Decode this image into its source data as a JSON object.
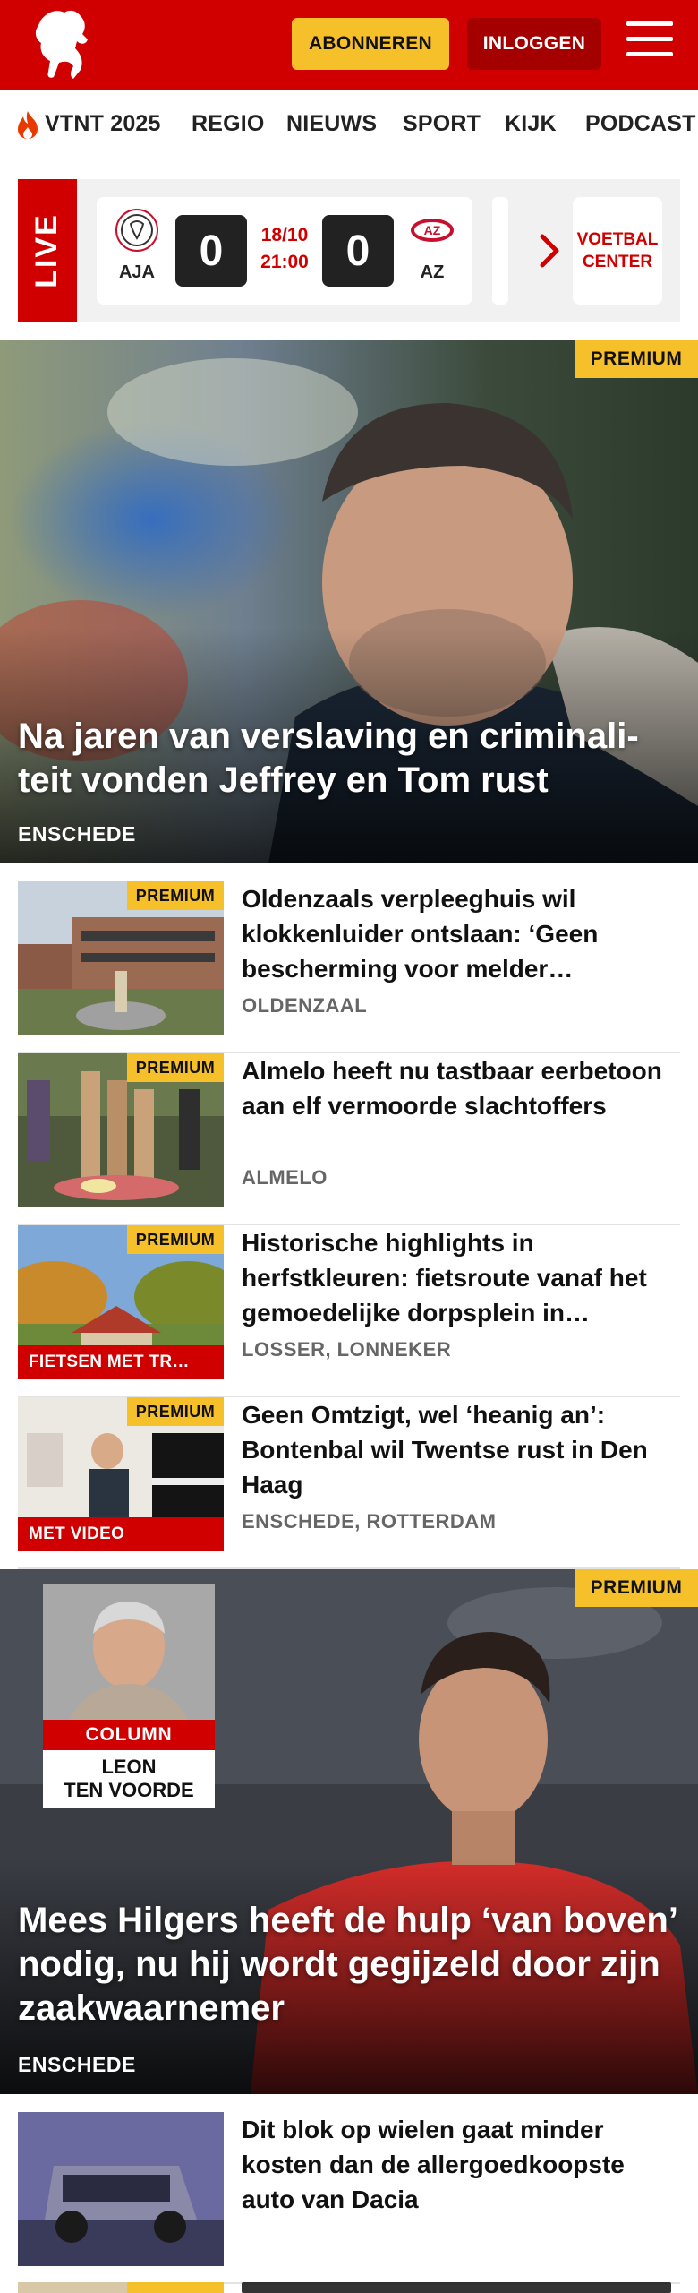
{
  "header": {
    "subscribe_label": "ABONNEREN",
    "login_label": "INLOGGEN",
    "brand_color": "#d00000",
    "accent_color": "#f5c02a",
    "logo_icon": "twente-horse-logo",
    "menu_icon": "hamburger-menu-icon"
  },
  "nav": {
    "items": [
      "VTNT 2025",
      "REGIO",
      "NIEUWS",
      "SPORT",
      "KIJK",
      "PODCAST"
    ],
    "active_icon": "flame-icon"
  },
  "live": {
    "label": "LIVE",
    "match": {
      "home_abbr": "AJA",
      "away_abbr": "AZ",
      "home_score": "0",
      "away_score": "0",
      "date": "18/10",
      "time": "21:00"
    },
    "voetbal_center": "VOETBAL CENTER"
  },
  "hero1": {
    "premium": "PREMIUM",
    "title": "Na jaren van verslaving en criminali-teit vonden Jeffrey en Tom rust",
    "location": "ENSCHEDE"
  },
  "articles": [
    {
      "premium": "PREMIUM",
      "title": "Oldenzaals verpleeghuis wil klokkenluider ontslaan: ‘Geen bescherming voor melder…",
      "location": "OLDENZAAL",
      "tag": ""
    },
    {
      "premium": "PREMIUM",
      "title": "Almelo heeft nu tastbaar eerbetoon aan elf vermoorde slachtoffers",
      "location": "ALMELO",
      "tag": ""
    },
    {
      "premium": "PREMIUM",
      "title": "Historische highlights in herfstkleuren: fietsroute vanaf het gemoedelijke dorpsplein in…",
      "location": "LOSSER, LONNEKER",
      "tag": "FIETSEN MET TR…"
    },
    {
      "premium": "PREMIUM",
      "title": "Geen Omtzigt, wel ‘heanig an’: Bontenbal wil Twentse rust in Den Haag",
      "location": "ENSCHEDE, ROTTERDAM",
      "tag": "MET VIDEO"
    }
  ],
  "hero2": {
    "premium": "PREMIUM",
    "column_label": "COLUMN",
    "columnist_first": "LEON",
    "columnist_last": "TEN VOORDE",
    "title": "Mees Hilgers heeft de hulp ‘van boven’ nodig, nu hij wordt gegijzeld door zijn zaakwaarnemer",
    "location": "ENSCHEDE"
  },
  "article_after": {
    "title": "Dit blok op wielen gaat minder kosten dan de allergoedkoopste auto van Dacia",
    "location": ""
  },
  "article_partial": {
    "premium": "PREMIUM"
  }
}
